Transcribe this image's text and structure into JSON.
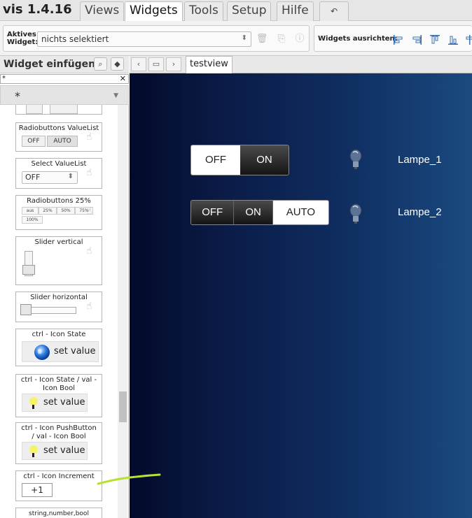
{
  "app": {
    "title": "vis 1.4.16"
  },
  "menu": {
    "tabs": [
      "Views",
      "Widgets",
      "Tools",
      "Setup",
      "Hilfe"
    ],
    "active": "Widgets",
    "undo_icon": "undo-icon"
  },
  "toolbar": {
    "active_widget_label_1": "Aktives",
    "active_widget_label_2": "Widget:",
    "active_widget_value": "nichts selektiert",
    "align_label": "Widgets ausrichten:"
  },
  "sidebar": {
    "title": "Widget einfügen",
    "filter_value": "*",
    "filter_select_value": "*",
    "widgets": {
      "radio_valuelist": {
        "title": "Radiobuttons ValueList",
        "opt_off": "OFF",
        "opt_auto": "AUTO"
      },
      "select_valuelist": {
        "title": "Select ValueList",
        "value": "OFF"
      },
      "radio_25": {
        "title": "Radiobuttons 25%",
        "opts": [
          "aus",
          "25%",
          "50%",
          "75%",
          "100%"
        ]
      },
      "slider_vertical": {
        "title": "Slider vertical"
      },
      "slider_horizontal": {
        "title": "Slider horizontal"
      },
      "icon_state": {
        "title": "ctrl - Icon State",
        "button": "set value"
      },
      "icon_state_val": {
        "title_1": "ctrl - Icon State / val -",
        "title_2": "Icon Bool",
        "button": "set value"
      },
      "icon_pushbutton": {
        "title_1": "ctrl - Icon PushButton",
        "title_2": "/ val - Icon Bool",
        "button": "set value"
      },
      "icon_increment": {
        "title": "ctrl - Icon Increment",
        "button": "+1"
      },
      "string_number_bool": {
        "title": "string,number,bool"
      }
    }
  },
  "view": {
    "tab": "testview",
    "switch1": {
      "off": "OFF",
      "on": "ON",
      "label": "Lampe_1"
    },
    "switch2": {
      "off": "OFF",
      "on": "ON",
      "auto": "AUTO",
      "label": "Lampe_2"
    }
  },
  "colors": {
    "canvas_dark": "#030a2a",
    "canvas_light": "#1a4a80",
    "annotation_stroke": "#b8e030"
  }
}
